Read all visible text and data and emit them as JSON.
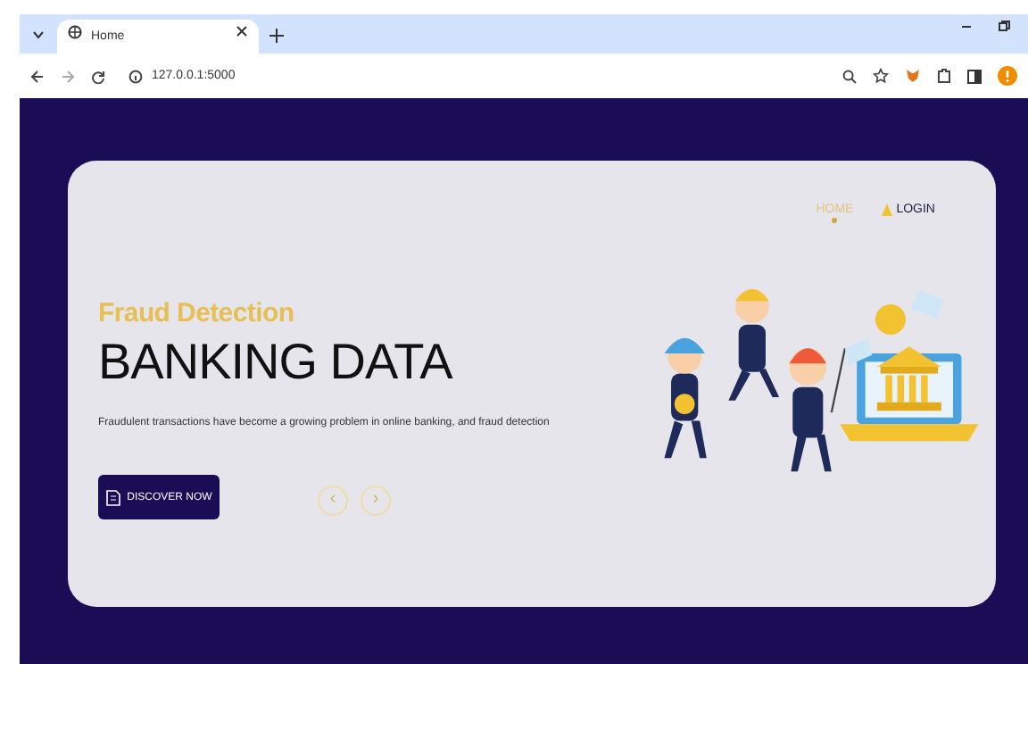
{
  "browser": {
    "tab_title": "Home",
    "url": "127.0.0.1:5000"
  },
  "nav": [
    {
      "label": "HOME",
      "selected": true
    },
    {
      "label": "LOGIN",
      "selected": false
    }
  ],
  "hero": {
    "kicker": "Fraud Detection",
    "title": "BANKING DATA",
    "description": "Fraudulent transactions have become a growing problem in online banking, and fraud detection",
    "button": "DISCOVER NOW"
  },
  "carousel_controls": [
    {
      "symbol": "‹"
    },
    {
      "symbol": "›"
    }
  ]
}
